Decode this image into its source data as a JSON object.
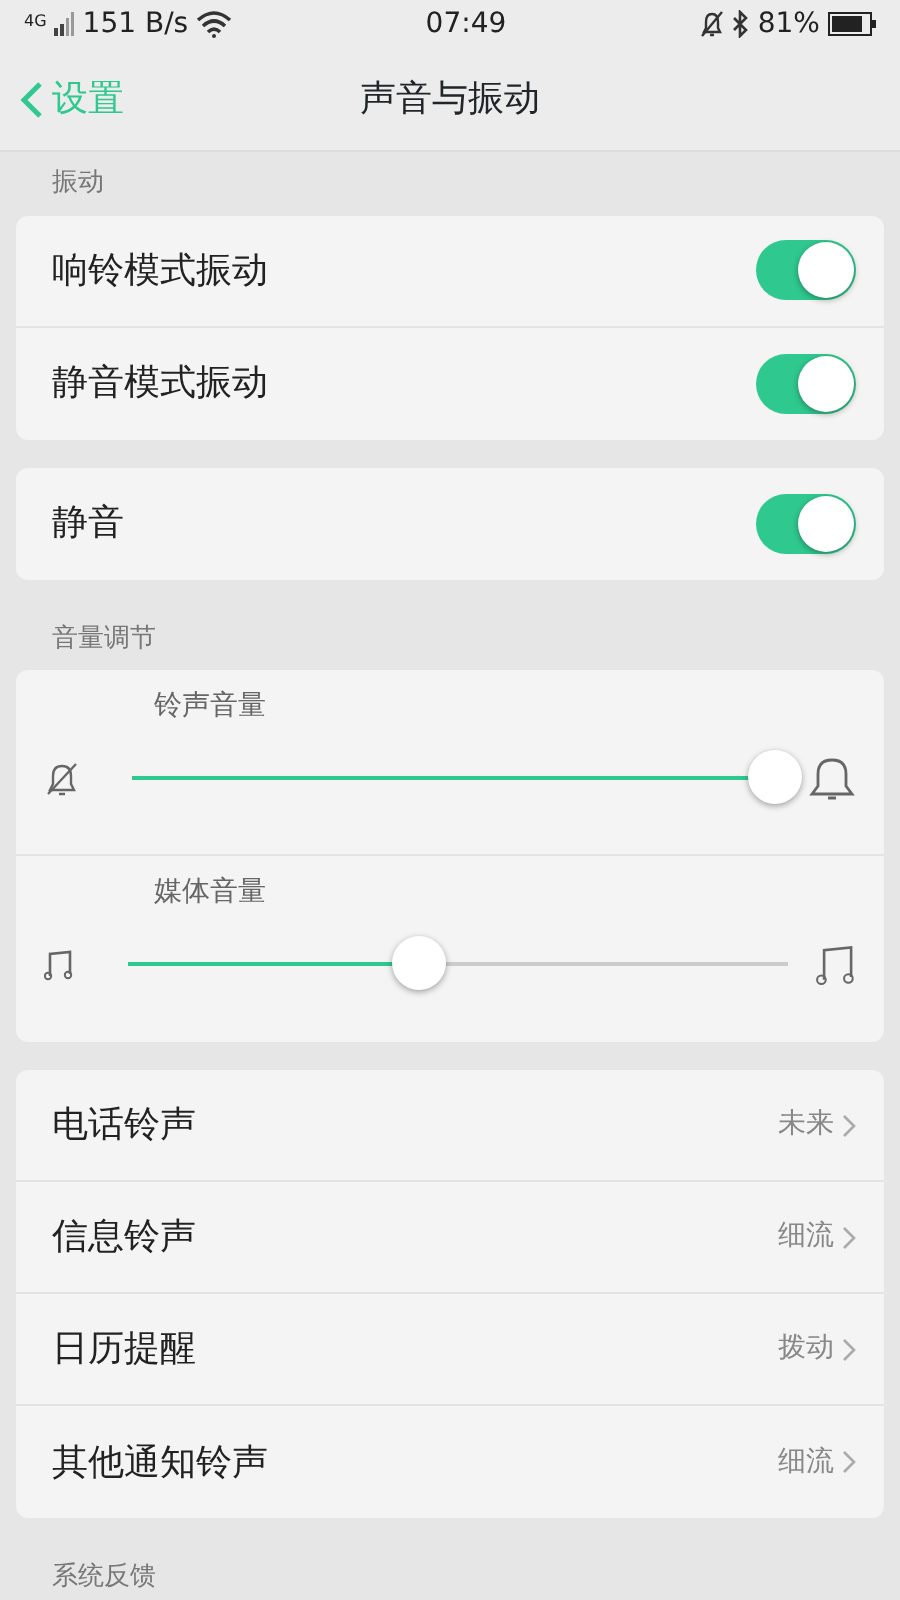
{
  "status_bar": {
    "network_type": "4G",
    "speed": "151 B/s",
    "time": "07:49",
    "battery": "81%"
  },
  "header": {
    "back": "设置",
    "title": "声音与振动"
  },
  "sections": [
    {
      "label": "振动",
      "groups": [
        [
          {
            "kind": "toggle",
            "label": "响铃模式振动",
            "on": true
          },
          {
            "kind": "toggle",
            "label": "静音模式振动",
            "on": true
          }
        ],
        [
          {
            "kind": "toggle",
            "label": "静音",
            "on": true
          }
        ]
      ]
    },
    {
      "label": "音量调节",
      "groups": [
        [
          {
            "kind": "slider",
            "label": "铃声音量",
            "level": 0.99
          },
          {
            "kind": "slider",
            "label": "媒体音量",
            "level": 0.44
          }
        ],
        [
          {
            "kind": "link",
            "label": "电话铃声",
            "value": "未来"
          },
          {
            "kind": "link",
            "label": "信息铃声",
            "value": "细流"
          },
          {
            "kind": "link",
            "label": "日历提醒",
            "value": "拨动"
          },
          {
            "kind": "link",
            "label": "其他通知铃声",
            "value": "细流"
          }
        ]
      ]
    },
    {
      "label": "系统反馈"
    }
  ]
}
